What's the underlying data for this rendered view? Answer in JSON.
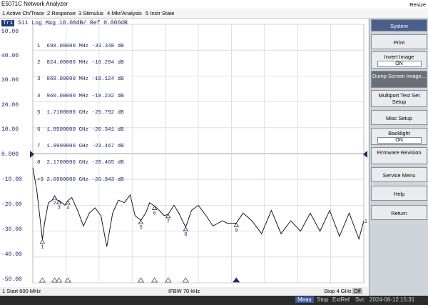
{
  "window": {
    "title": "E5071C Network Analyzer",
    "resize_label": "Resize"
  },
  "menu": [
    "1 Active Ch/Trace",
    "2 Response",
    "3 Stimulus",
    "4 Mkr/Analysis",
    "5 Instr State"
  ],
  "trace": {
    "badge": "Tr1",
    "label": "S11 Log Mag 10.00dB/ Ref 0.000dB"
  },
  "markers": [
    {
      "id": "1",
      "freq": "698.00000 MHz",
      "value": "-33.348 dB"
    },
    {
      "id": "2",
      "freq": "824.00000 MHz",
      "value": "-16.294 dB"
    },
    {
      "id": "3",
      "freq": "868.00000 MHz",
      "value": "-18.124 dB"
    },
    {
      "id": "4",
      "freq": "960.00000 MHz",
      "value": "-18.232 dB"
    },
    {
      "id": "5",
      "freq": "1.7100000 GHz",
      "value": "-25.792 dB"
    },
    {
      "id": "6",
      "freq": "1.8500000 GHz",
      "value": "-20.341 dB"
    },
    {
      "id": "7",
      "freq": "1.9900000 GHz",
      "value": "-23.467 dB"
    },
    {
      "id": "8",
      "freq": "2.1700000 GHz",
      "value": "-28.465 dB"
    },
    {
      "id": ">9",
      "freq": "2.6900000 GHz",
      "value": "-26.943 dB"
    }
  ],
  "y_ticks": [
    "50.00",
    "40.00",
    "30.00",
    "20.00",
    "10.00",
    "0.000",
    "-10.00",
    "-20.00",
    "-30.00",
    "-40.00",
    "-50.00"
  ],
  "status": {
    "start": "1  Start 600 MHz",
    "ifbw": "IFBW 70 kHz",
    "stop": "Stop 4 GHz",
    "off": "Off"
  },
  "bottom": {
    "meas": "Meas",
    "stop": "Stop",
    "extref": "ExtRef",
    "svc": "Svc",
    "datetime": "2024-06-12 15:31"
  },
  "softkeys": [
    {
      "label": "System",
      "style": "head"
    },
    {
      "label": "Print",
      "style": "normal"
    },
    {
      "label": "Invert Image",
      "sub": "ON",
      "style": "normal"
    },
    {
      "label": "Dump Screen Image...",
      "style": "dark"
    },
    {
      "label": "Multiport Test Set Setup",
      "style": "normal"
    },
    {
      "label": "Misc Setup",
      "style": "normal"
    },
    {
      "label": "Backlight",
      "sub": "ON",
      "style": "normal"
    },
    {
      "label": "Firmware Revision",
      "style": "normal"
    },
    {
      "label": "Service Menu",
      "style": "normal"
    },
    {
      "label": "Help",
      "style": "normal"
    },
    {
      "label": "Return",
      "style": "normal"
    }
  ],
  "chart_data": {
    "type": "line",
    "title": "S11 Log Mag 10.00dB/ Ref 0.000dB",
    "xlabel": "",
    "ylabel": "",
    "xlim": [
      600,
      4000
    ],
    "ylim": [
      -50,
      50
    ],
    "grid": true,
    "series": [
      {
        "x": [
          600,
          640,
          680,
          698,
          720,
          760,
          800,
          824,
          850,
          868,
          900,
          930,
          960,
          1000,
          1060,
          1120,
          1180,
          1240,
          1300,
          1360,
          1420,
          1480,
          1540,
          1600,
          1650,
          1710,
          1760,
          1800,
          1850,
          1900,
          1950,
          1990,
          2050,
          2100,
          2170,
          2230,
          2300,
          2380,
          2450,
          2550,
          2600,
          2650,
          2690,
          2760,
          2850,
          2950,
          3050,
          3150,
          3250,
          3350,
          3450,
          3550,
          3650,
          3750,
          3850,
          3950,
          4000
        ],
        "y": [
          -5.5,
          -14,
          -27,
          -33.3,
          -27,
          -19,
          -18,
          -16.3,
          -18,
          -18.1,
          -19,
          -20,
          -18.2,
          -17,
          -22,
          -28,
          -23,
          -21,
          -24,
          -36,
          -23,
          -18,
          -19,
          -16,
          -24,
          -25.8,
          -23,
          -19,
          -20.3,
          -22,
          -24,
          -23.5,
          -20,
          -23,
          -28.5,
          -22,
          -20,
          -24,
          -28,
          -26,
          -27,
          -27,
          -26.9,
          -23,
          -26,
          -31,
          -22,
          -31,
          -26,
          -30,
          -23,
          -30,
          -22,
          -32,
          -23,
          -33,
          -26
        ]
      }
    ],
    "marker_points": [
      {
        "label": "1",
        "x": 698,
        "y": -33.348
      },
      {
        "label": "2",
        "x": 824,
        "y": -16.294
      },
      {
        "label": "3",
        "x": 868,
        "y": -18.124
      },
      {
        "label": "4",
        "x": 960,
        "y": -18.232
      },
      {
        "label": "5",
        "x": 1710,
        "y": -25.792
      },
      {
        "label": "6",
        "x": 1850,
        "y": -20.341
      },
      {
        "label": "7",
        "x": 1990,
        "y": -23.467
      },
      {
        "label": "8",
        "x": 2170,
        "y": -28.465
      },
      {
        "label": "9",
        "x": 2690,
        "y": -26.943
      }
    ]
  }
}
